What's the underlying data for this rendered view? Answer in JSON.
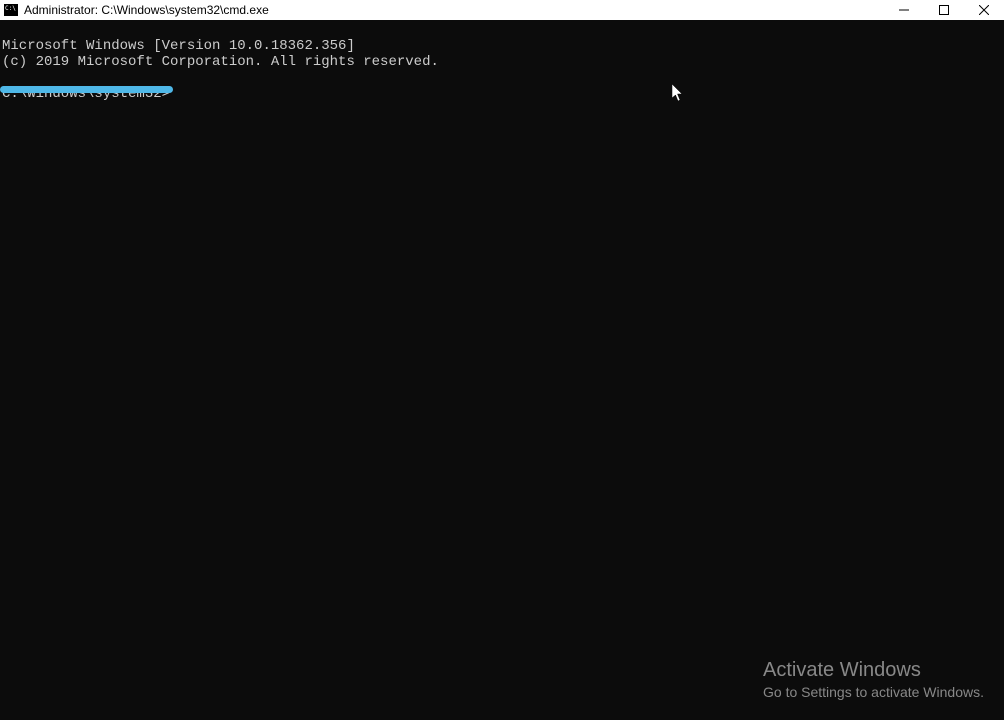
{
  "titlebar": {
    "title": "Administrator: C:\\Windows\\system32\\cmd.exe"
  },
  "terminal": {
    "line1": "Microsoft Windows [Version 10.0.18362.356]",
    "line2": "(c) 2019 Microsoft Corporation. All rights reserved.",
    "prompt": "C:\\Windows\\system32>"
  },
  "watermark": {
    "title": "Activate Windows",
    "subtitle": "Go to Settings to activate Windows."
  },
  "annotation": {
    "color": "#4fb8e8"
  }
}
